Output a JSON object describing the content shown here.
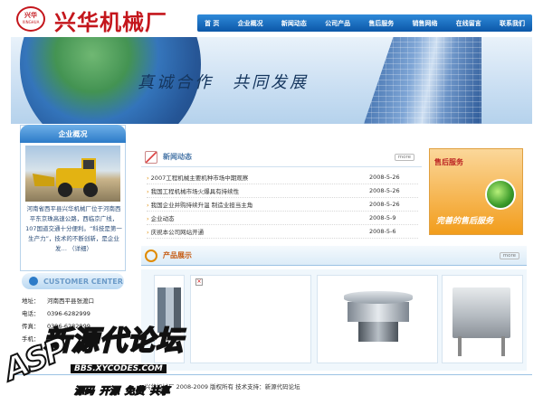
{
  "header": {
    "logo_text": "兴华",
    "logo_subtext": "XINGHUA",
    "company_name": "兴华机械厂"
  },
  "nav": {
    "items": [
      "首 页",
      "企业概况",
      "新闻动态",
      "公司产品",
      "售后服务",
      "销售网络",
      "在线留言",
      "联系我们"
    ]
  },
  "banner": {
    "slogan": "真诚合作　共同发展"
  },
  "about": {
    "heading": "企业概况",
    "text": "河南省西平县兴华机械厂位于河南西平东京珠高速公路，西临京广线，107国道交通十分便利。“科技是第一生产力”，技术的不断创新，是企业发… （详细）"
  },
  "customer_center": {
    "label": "CUSTOMER CENTER"
  },
  "contact": {
    "rows": [
      {
        "key": "地址：",
        "value": "河南西平县张渡口"
      },
      {
        "key": "电话：",
        "value": "0396-6282999"
      },
      {
        "key": "传真：",
        "value": "0396-6282999"
      },
      {
        "key": "手机：",
        "value": ""
      }
    ]
  },
  "news": {
    "heading": "新闻动态",
    "more": "more",
    "items": [
      {
        "title": "2007工程机械主要机种市场中期观察",
        "date": "2008-5-26"
      },
      {
        "title": "我国工程机械市场火爆具有持续性",
        "date": "2008-5-26"
      },
      {
        "title": "我国企业并购持续升温 制造业担当主角",
        "date": "2008-5-26"
      },
      {
        "title": "企业动态",
        "date": "2008-5-9"
      },
      {
        "title": "庆祝本公司网站开通",
        "date": "2008-5-6"
      }
    ]
  },
  "service": {
    "title": "售后服务",
    "caption": "完善的售后服务"
  },
  "products": {
    "heading": "产品展示",
    "more": "more"
  },
  "footer": {
    "text": "兴华机械厂  2008-2009 版权所有  技术支持：新源代码论坛"
  },
  "watermark": {
    "asp": "ASP",
    "site": "新源代论坛",
    "url": "BBS.XYCODES.COM",
    "tagline": "源码 开源 免费 共享"
  }
}
